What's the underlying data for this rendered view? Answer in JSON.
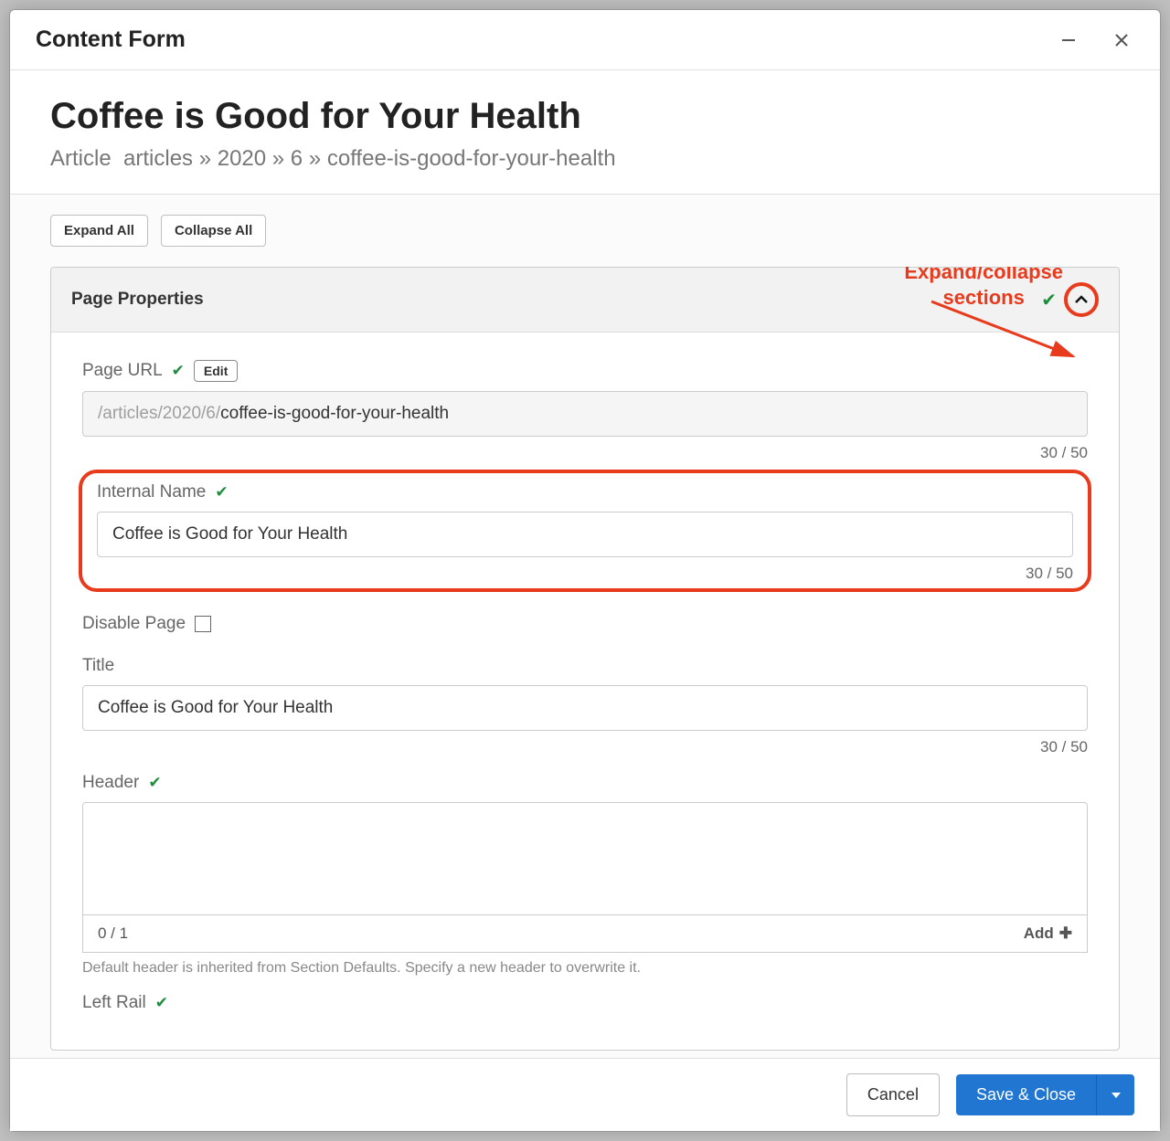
{
  "modal": {
    "title": "Content Form"
  },
  "content": {
    "title": "Coffee is Good for Your Health",
    "breadcrumb_type": "Article",
    "breadcrumb_path": "articles » 2020 » 6 » coffee-is-good-for-your-health"
  },
  "toolbar": {
    "expand_all": "Expand All",
    "collapse_all": "Collapse All"
  },
  "annotation": {
    "line1": "Expand/collapse",
    "line2": "sections"
  },
  "section": {
    "title": "Page Properties"
  },
  "fields": {
    "page_url": {
      "label": "Page URL",
      "edit_label": "Edit",
      "prefix": "/articles/2020/6/",
      "value": "coffee-is-good-for-your-health",
      "counter": "30 / 50"
    },
    "internal_name": {
      "label": "Internal Name",
      "value": "Coffee is Good for Your Health",
      "counter": "30 / 50"
    },
    "disable_page": {
      "label": "Disable Page"
    },
    "title": {
      "label": "Title",
      "value": "Coffee is Good for Your Health",
      "counter": "30 / 50"
    },
    "header": {
      "label": "Header",
      "counter": "0 / 1",
      "add_label": "Add",
      "helper": "Default header is inherited from Section Defaults. Specify a new header to overwrite it."
    },
    "left_rail": {
      "label": "Left Rail"
    }
  },
  "footer": {
    "cancel": "Cancel",
    "save": "Save & Close"
  }
}
